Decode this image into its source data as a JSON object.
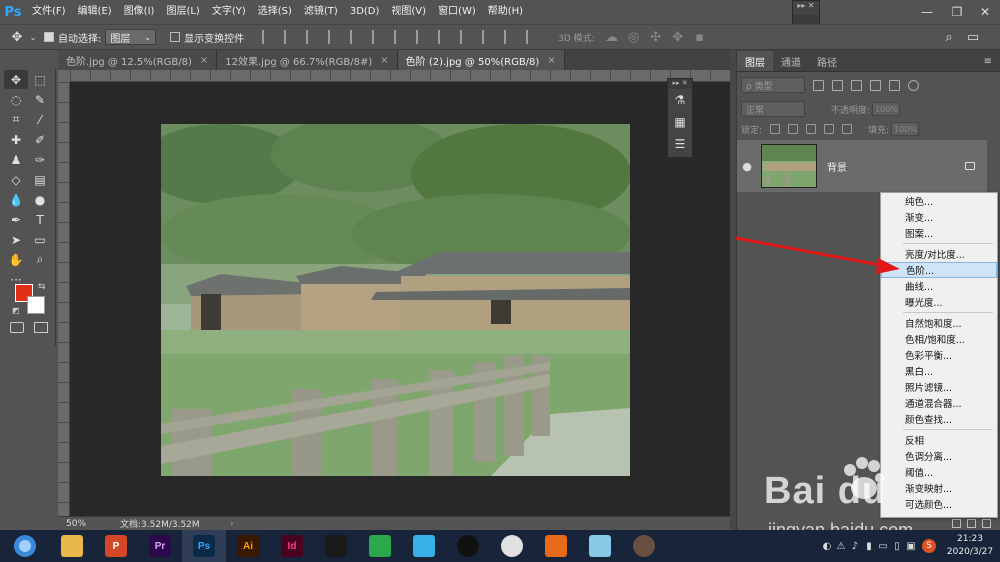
{
  "app": {
    "logo": "Ps"
  },
  "menu": [
    "文件(F)",
    "编辑(E)",
    "图像(I)",
    "图层(L)",
    "文字(Y)",
    "选择(S)",
    "滤镜(T)",
    "3D(D)",
    "视图(V)",
    "窗口(W)",
    "帮助(H)"
  ],
  "window_controls": {
    "minimize": "—",
    "restore": "❐",
    "close": "✕"
  },
  "mini_panel": {
    "header": "▸▸ ✕",
    "play": "▶"
  },
  "options": {
    "auto_select_label": "自动选择:",
    "auto_select_value": "图层",
    "transform_label": "显示变换控件",
    "mode_3d_label": "3D 模式:"
  },
  "tabs": [
    {
      "label": "色阶.jpg @ 12.5%(RGB/8)",
      "close": "×"
    },
    {
      "label": "12效果.jpg @ 66.7%(RGB/8#)",
      "close": "×"
    },
    {
      "label": "色阶 (2).jpg @ 50%(RGB/8)",
      "close": "×"
    }
  ],
  "float_tools": {
    "header": "▸▸ ✕"
  },
  "status": {
    "zoom": "50%",
    "doc": "文档:3.52M/3.52M",
    "arrow": "›"
  },
  "panel_tabs": [
    "图层",
    "通道",
    "路径"
  ],
  "panel_menu": "≡",
  "layers": {
    "filter_kind": "ρ 类型",
    "blend_mode": "正常",
    "opacity_label": "不透明度:",
    "opacity_value": "100%",
    "lock_label": "锁定:",
    "fill_label": "填充:",
    "fill_value": "100%",
    "items": [
      {
        "name": "背景",
        "visible_icon": "●"
      }
    ]
  },
  "adjustment_menu": {
    "groups": [
      [
        "纯色...",
        "渐变...",
        "图案..."
      ],
      [
        "亮度/对比度...",
        "色阶...",
        "曲线...",
        "曝光度..."
      ],
      [
        "自然饱和度...",
        "色相/饱和度...",
        "色彩平衡...",
        "黑白...",
        "照片滤镜...",
        "通道混合器...",
        "颜色查找..."
      ],
      [
        "反相",
        "色调分离...",
        "阈值...",
        "渐变映射...",
        "可选颜色..."
      ]
    ],
    "highlighted": "色阶..."
  },
  "watermark": {
    "logo": "Bai du",
    "url": "jingyan.baidu.com"
  },
  "taskbar": {
    "apps": [
      {
        "name": "file-explorer",
        "label": "",
        "color": "#e8b84a"
      },
      {
        "name": "powerpoint",
        "label": "P",
        "color": "#d24726"
      },
      {
        "name": "premiere",
        "label": "Pr",
        "color": "#2a0a4a"
      },
      {
        "name": "photoshop",
        "label": "Ps",
        "color": "#0b2a4a"
      },
      {
        "name": "illustrator",
        "label": "Ai",
        "color": "#3a1800"
      },
      {
        "name": "indesign",
        "label": "Id",
        "color": "#49021f"
      },
      {
        "name": "video-editor",
        "label": "",
        "color": "#1a1a1a"
      },
      {
        "name": "app-green",
        "label": "",
        "color": "#2aa84a"
      },
      {
        "name": "app-cloud",
        "label": "",
        "color": "#3ab0e8"
      },
      {
        "name": "qq",
        "label": "",
        "color": "#111111"
      },
      {
        "name": "chrome",
        "label": "",
        "color": "#e0e0e0"
      },
      {
        "name": "app-orange",
        "label": "",
        "color": "#e86a1a"
      },
      {
        "name": "app-glass",
        "label": "",
        "color": "#8ac8e8"
      },
      {
        "name": "avatar",
        "label": "",
        "color": "#6a5040"
      }
    ],
    "clock_time": "21:23",
    "clock_date": "2020/3/27"
  },
  "colors": {
    "foreground": "#e03018",
    "background": "#ffffff",
    "accent": "#31a8ff",
    "arrow": "#e01818"
  }
}
